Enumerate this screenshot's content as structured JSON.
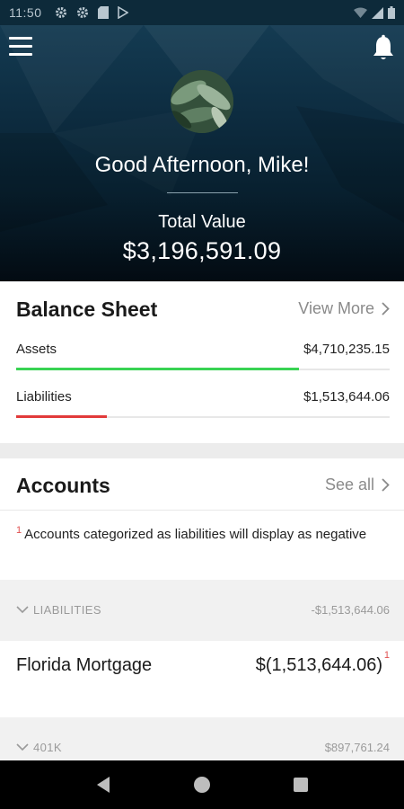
{
  "status_bar": {
    "time": "11:50",
    "left_icons": [
      "gear-icon",
      "gear-icon",
      "sd-card-icon",
      "play-store-icon"
    ],
    "right_icons": [
      "wifi-icon",
      "signal-icon",
      "battery-icon"
    ]
  },
  "header": {
    "greeting": "Good Afternoon, Mike!",
    "total_label": "Total Value",
    "total_value": "$3,196,591.09",
    "menu_icon": "hamburger-menu-icon",
    "bell_icon": "bell-icon"
  },
  "balance_sheet": {
    "title": "Balance Sheet",
    "link_label": "View More",
    "rows": [
      {
        "label": "Assets",
        "value": "$4,710,235.15",
        "progress": 0.757,
        "color": "#39d353"
      },
      {
        "label": "Liabilities",
        "value": "$1,513,644.06",
        "progress": 0.243,
        "color": "#e23a3a"
      }
    ]
  },
  "accounts": {
    "title": "Accounts",
    "link_label": "See all",
    "note_marker": "1",
    "note": "Accounts categorized as liabilities will display as negative",
    "groups": [
      {
        "label": "LIABILITIES",
        "value": "-$1,513,644.06",
        "accounts": [
          {
            "name": "Florida Mortgage",
            "value": "$(1,513,644.06)",
            "marker": "1"
          }
        ]
      },
      {
        "label": "401K",
        "value": "$897,761.24",
        "accounts": []
      }
    ]
  },
  "nav_bar": {
    "back_icon": "back-triangle-icon",
    "home_icon": "home-circle-icon",
    "recents_icon": "recents-square-icon"
  }
}
